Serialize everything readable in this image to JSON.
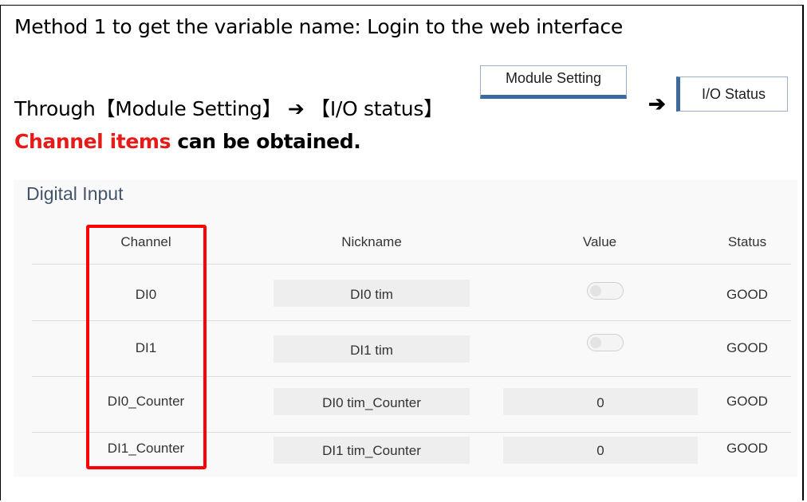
{
  "heading": "Method 1 to get the variable name: Login to the web interface",
  "instruction": {
    "prefix": "Through【Module Setting】",
    "arrow1": "➔",
    "middle": "【I/O status】"
  },
  "buttons": {
    "module_setting": "Module Setting",
    "arrow2": "➔",
    "io_status": "I/O Status"
  },
  "note": {
    "highlight": "Channel items",
    "rest": " can be obtained."
  },
  "panel": {
    "title": "Digital Input",
    "columns": [
      "Channel",
      "Nickname",
      "Value",
      "Status"
    ],
    "rows": [
      {
        "channel": "DI0",
        "nickname": "DI0 tim",
        "value_type": "toggle",
        "value_state": "off",
        "status": "GOOD"
      },
      {
        "channel": "DI1",
        "nickname": "DI1 tim",
        "value_type": "toggle",
        "value_state": "off",
        "status": "GOOD"
      },
      {
        "channel": "DI0_Counter",
        "nickname": "DI0 tim_Counter",
        "value": "0",
        "status": "GOOD"
      },
      {
        "channel": "DI1_Counter",
        "nickname": "DI1 tim_Counter",
        "value": "0",
        "status": "GOOD"
      }
    ]
  },
  "colors": {
    "highlight": "#ff0000",
    "note_red": "#e41b17",
    "accent": "#3d6a9e"
  }
}
